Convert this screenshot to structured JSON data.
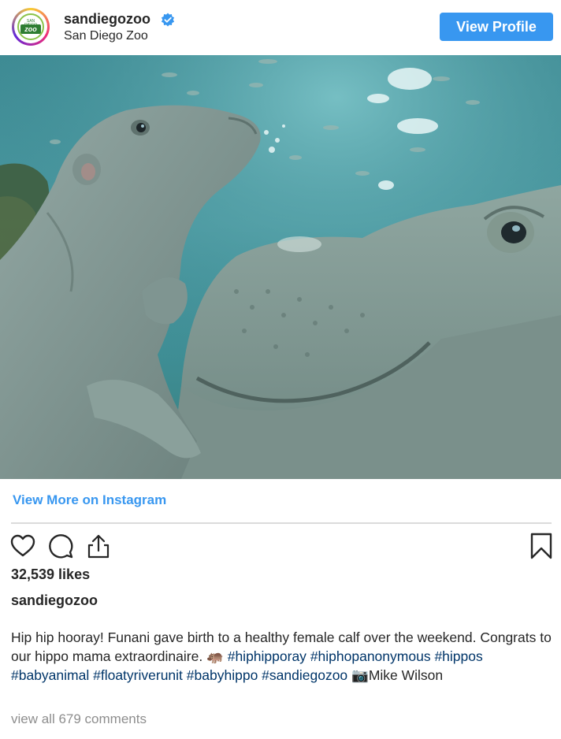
{
  "header": {
    "avatar_badge_top": "SAN DIEGO",
    "avatar_badge_main": "zoo",
    "username": "sandiegozoo",
    "full_name": "San Diego Zoo",
    "view_profile_label": "View Profile"
  },
  "colors": {
    "accent_blue": "#3897f0",
    "hashtag_blue": "#003569",
    "muted_gray": "#8e8e8e",
    "water_teal": "#4a98a0"
  },
  "post": {
    "image_subject": "baby hippo and mother hippo underwater",
    "view_more_label": "View More on Instagram",
    "likes": "32,539 likes",
    "author": "sandiegozoo",
    "caption_text_1": "Hip hip hooray! Funani gave birth to a healthy female calf over the weekend. Congrats to our hippo mama extraordinaire. ",
    "caption_emoji_hippo": "🦛",
    "hashtags": {
      "hiphipporay": "#hiphipporay",
      "hiphopanonymous": "#hiphopanonymous",
      "hippos": "#hippos",
      "babyanimal": "#babyanimal",
      "floatyriverunit": "#floatyriverunit",
      "babyhippo": "#babyhippo",
      "sandiegozoo": "#sandiegozoo"
    },
    "caption_emoji_camera": "📷",
    "credit": "Mike Wilson",
    "comments_link": "view all 679 comments"
  },
  "icons": {
    "like": "heart-icon",
    "comment": "comment-icon",
    "share": "share-icon",
    "save": "bookmark-icon",
    "verified": "verified-badge-icon"
  }
}
